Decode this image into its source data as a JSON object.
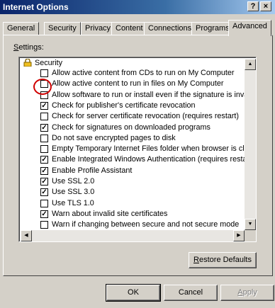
{
  "window": {
    "title": "Internet Options",
    "help_label": "?",
    "close_label": "×"
  },
  "tabs": [
    {
      "label": "General"
    },
    {
      "label": "Security"
    },
    {
      "label": "Privacy"
    },
    {
      "label": "Content"
    },
    {
      "label": "Connections"
    },
    {
      "label": "Programs"
    },
    {
      "label": "Advanced",
      "active": true
    }
  ],
  "settings": {
    "label_accel": "S",
    "label_rest": "ettings:",
    "category": "Security",
    "items": [
      {
        "label": "Allow active content from CDs to run on My Computer",
        "checked": false
      },
      {
        "label": "Allow active content to run in files on My Computer",
        "checked": false,
        "highlighted": true
      },
      {
        "label": "Allow software to run or install even if the signature is invalid",
        "checked": false
      },
      {
        "label": "Check for publisher's certificate revocation",
        "checked": true
      },
      {
        "label": "Check for server certificate revocation (requires restart)",
        "checked": false
      },
      {
        "label": "Check for signatures on downloaded programs",
        "checked": true
      },
      {
        "label": "Do not save encrypted pages to disk",
        "checked": false
      },
      {
        "label": "Empty Temporary Internet Files folder when browser is closed",
        "checked": false
      },
      {
        "label": "Enable Integrated Windows Authentication (requires restart)",
        "checked": true
      },
      {
        "label": "Enable Profile Assistant",
        "checked": true
      },
      {
        "label": "Use SSL 2.0",
        "checked": true
      },
      {
        "label": "Use SSL 3.0",
        "checked": true
      },
      {
        "label": "Use TLS 1.0",
        "checked": false
      },
      {
        "label": "Warn about invalid site certificates",
        "checked": true
      },
      {
        "label": "Warn if changing between secure and not secure mode",
        "checked": false
      }
    ]
  },
  "buttons": {
    "restore_accel": "R",
    "restore_rest": "estore Defaults",
    "ok": "OK",
    "cancel": "Cancel",
    "apply_accel": "A",
    "apply_rest": "pply"
  },
  "colors": {
    "highlight_circle": "#d00000",
    "face": "#d4d0c8",
    "titlebar": "#0a246a"
  }
}
